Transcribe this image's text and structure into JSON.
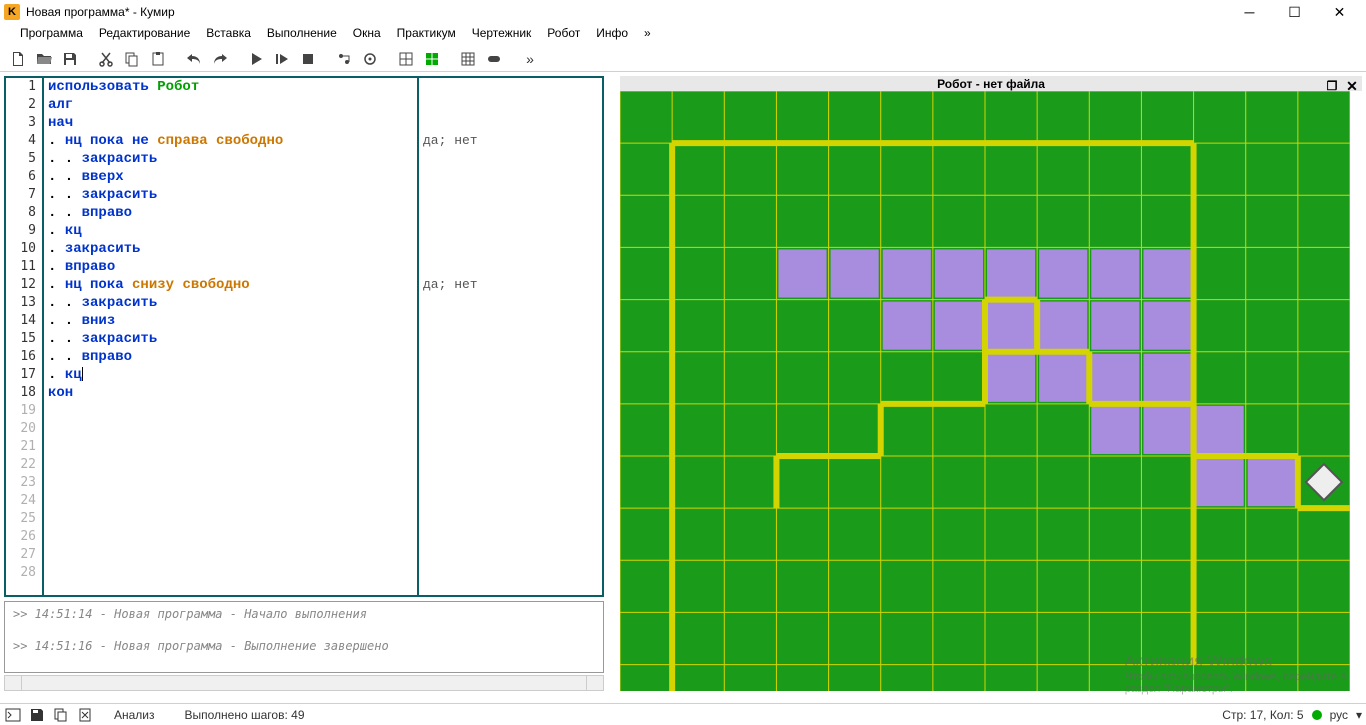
{
  "window": {
    "title": "Новая программа* - Кумир",
    "icon_letter": "K"
  },
  "menu": [
    "Программа",
    "Редактирование",
    "Вставка",
    "Выполнение",
    "Окна",
    "Практикум",
    "Чертежник",
    "Робот",
    "Инфо",
    "»"
  ],
  "code_lines": [
    {
      "n": 1,
      "html": "<span class='kw-use'>использовать </span><span class='kw-robot'>Робот</span>"
    },
    {
      "n": 2,
      "html": "<span class='kw-struct'>алг</span>"
    },
    {
      "n": 3,
      "html": "<span class='kw-struct'>нач</span>"
    },
    {
      "n": 4,
      "html": "<span class='dot'>. </span><span class='kw-struct'>нц пока не </span><span class='kw-cond'>справа свободно</span>",
      "margin": "да; нет"
    },
    {
      "n": 5,
      "html": "<span class='dot'>. . </span><span class='kw-cmd'>закрасить</span>"
    },
    {
      "n": 6,
      "html": "<span class='dot'>. . </span><span class='kw-cmd'>вверх</span>"
    },
    {
      "n": 7,
      "html": "<span class='dot'>. . </span><span class='kw-cmd'>закрасить</span>"
    },
    {
      "n": 8,
      "html": "<span class='dot'>. . </span><span class='kw-cmd'>вправо</span>"
    },
    {
      "n": 9,
      "html": "<span class='dot'>. </span><span class='kw-struct'>кц</span>"
    },
    {
      "n": 10,
      "html": "<span class='dot'>. </span><span class='kw-cmd'>закрасить</span>"
    },
    {
      "n": 11,
      "html": "<span class='dot'>. </span><span class='kw-cmd'>вправо</span>"
    },
    {
      "n": 12,
      "html": "<span class='dot'>. </span><span class='kw-struct'>нц пока </span><span class='kw-cond'>снизу свободно</span>",
      "margin": "да; нет"
    },
    {
      "n": 13,
      "html": "<span class='dot'>. . </span><span class='kw-cmd'>закрасить</span>"
    },
    {
      "n": 14,
      "html": "<span class='dot'>. . </span><span class='kw-cmd'>вниз</span>"
    },
    {
      "n": 15,
      "html": "<span class='dot'>. . </span><span class='kw-cmd'>закрасить</span>"
    },
    {
      "n": 16,
      "html": "<span class='dot'>. . </span><span class='kw-cmd'>вправо</span>"
    },
    {
      "n": 17,
      "html": "<span class='dot'>. </span><span class='kw-struct'>кц</span><span class='cursor'></span>"
    },
    {
      "n": 18,
      "html": "<span class='kw-struct'>кон</span>"
    }
  ],
  "empty_lines": [
    19,
    20,
    21,
    22,
    23,
    24,
    25,
    26,
    27,
    28
  ],
  "console": [
    ">> 14:51:14 - Новая программа - Начало выполнения",
    "",
    ">> 14:51:16 - Новая программа - Выполнение завершено"
  ],
  "robot": {
    "title": "Робот - нет файла",
    "cols": 14,
    "rows": 12,
    "cell": 50,
    "filled": [
      [
        3,
        3
      ],
      [
        4,
        3
      ],
      [
        5,
        3
      ],
      [
        5,
        4
      ],
      [
        6,
        3
      ],
      [
        6,
        4
      ],
      [
        7,
        3
      ],
      [
        7,
        4
      ],
      [
        7,
        5
      ],
      [
        8,
        3
      ],
      [
        8,
        4
      ],
      [
        8,
        5
      ],
      [
        9,
        3
      ],
      [
        9,
        4
      ],
      [
        9,
        5
      ],
      [
        9,
        6
      ],
      [
        10,
        3
      ],
      [
        10,
        4
      ],
      [
        10,
        5
      ],
      [
        10,
        6
      ],
      [
        11,
        6
      ],
      [
        11,
        7
      ],
      [
        12,
        7
      ]
    ],
    "walls": [
      [
        1,
        1,
        11,
        1
      ],
      [
        1,
        8,
        1,
        12
      ],
      [
        11,
        1,
        11,
        11
      ],
      [
        1,
        1,
        1,
        8
      ],
      [
        3,
        8,
        3,
        7
      ],
      [
        3,
        7,
        5,
        7
      ],
      [
        5,
        7,
        5,
        6
      ],
      [
        5,
        6,
        7,
        6
      ],
      [
        7,
        6,
        7,
        5
      ],
      [
        7,
        5,
        9,
        5
      ],
      [
        9,
        5,
        9,
        6
      ],
      [
        9,
        6,
        11,
        6
      ],
      [
        11,
        6,
        11,
        7
      ],
      [
        11,
        7,
        13,
        7
      ],
      [
        13,
        7,
        13,
        8
      ],
      [
        13,
        8,
        14,
        8
      ],
      [
        7,
        4,
        7,
        5
      ],
      [
        7,
        4,
        8,
        4
      ],
      [
        8,
        4,
        8,
        5
      ]
    ],
    "robot_pos": [
      13,
      7
    ]
  },
  "status": {
    "analysis": "Анализ",
    "steps_label": "Выполнено шагов:",
    "steps": 49,
    "cursor_label": "Стр: 17, Кол: 5",
    "lang": "рус"
  },
  "watermark": {
    "l1": "Активация Windows",
    "l2": "Чтобы активировать Windows, перейдите в",
    "l3": "раздел \"Параметры\"."
  }
}
